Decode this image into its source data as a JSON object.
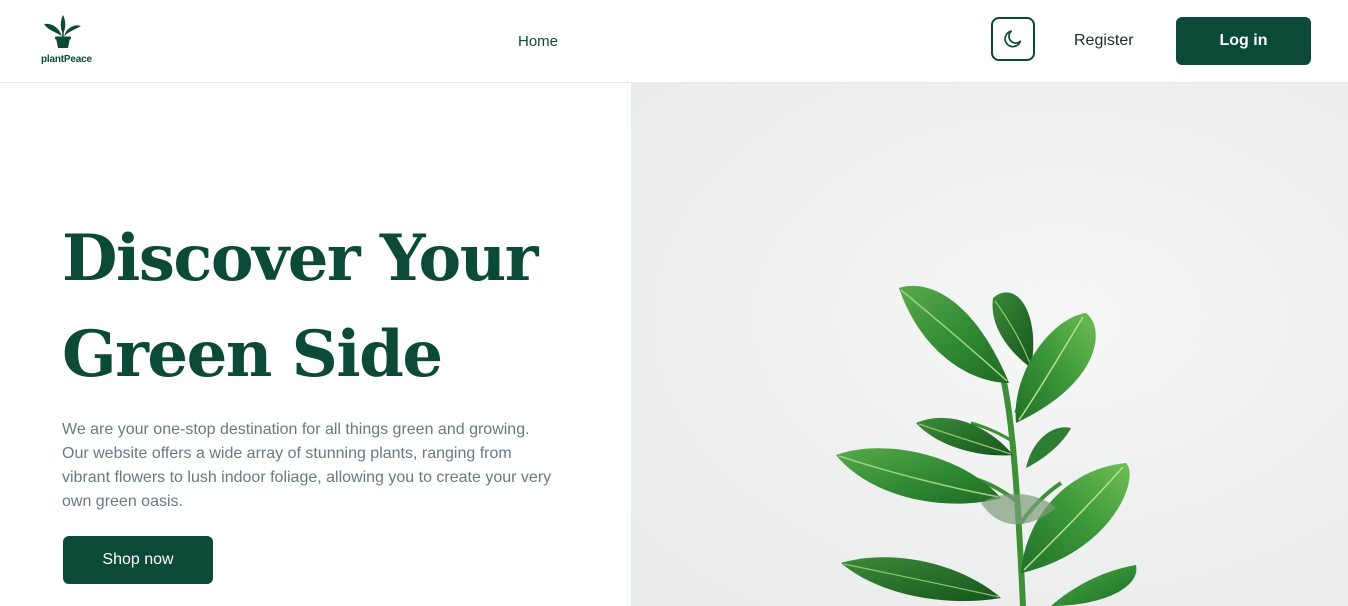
{
  "brand": {
    "name": "plantPeace"
  },
  "nav": {
    "home": "Home"
  },
  "header": {
    "theme_toggle_icon": "moon-icon",
    "register_label": "Register",
    "login_label": "Log in"
  },
  "hero": {
    "title_line1": "Discover Your",
    "title_line2": "Green Side",
    "description": "We are your one-stop destination for all things green and growing. Our website offers a wide array of stunning plants, ranging from vibrant flowers to lush indoor foliage, allowing you to create your very own green oasis.",
    "cta_label": "Shop now",
    "image_subject": "potted ficus plant"
  },
  "colors": {
    "brand_green": "#0b4a36",
    "text_muted": "#667a86",
    "image_bg": "#eef0f0"
  }
}
